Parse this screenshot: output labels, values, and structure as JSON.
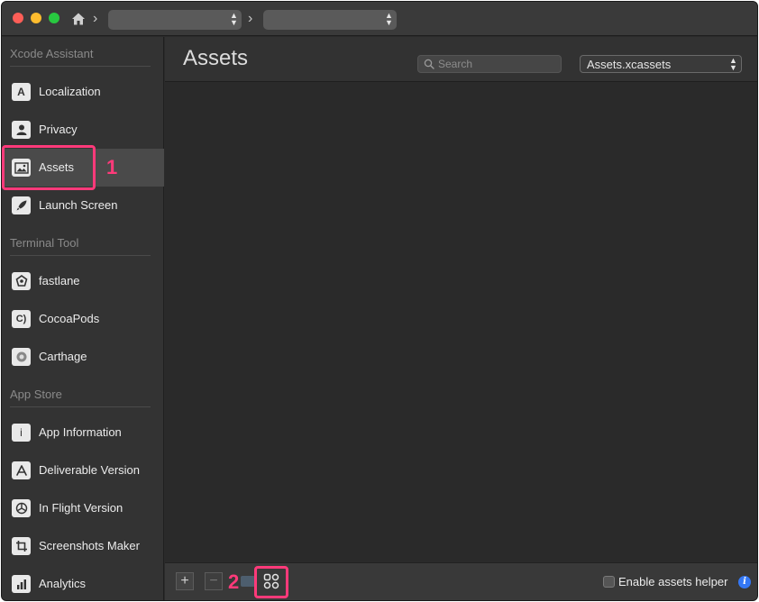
{
  "titlebar": {
    "breadcrumb_1": "",
    "breadcrumb_2": ""
  },
  "sidebar": {
    "sections": [
      {
        "title": "Xcode Assistant",
        "items": [
          {
            "label": "Localization",
            "icon": "letter-a-icon"
          },
          {
            "label": "Privacy",
            "icon": "person-icon"
          },
          {
            "label": "Assets",
            "icon": "image-icon"
          },
          {
            "label": "Launch Screen",
            "icon": "rocket-icon"
          }
        ]
      },
      {
        "title": "Terminal Tool",
        "items": [
          {
            "label": "fastlane",
            "icon": "fastlane-icon"
          },
          {
            "label": "CocoaPods",
            "icon": "cocoapods-icon"
          },
          {
            "label": "Carthage",
            "icon": "carthage-icon"
          }
        ]
      },
      {
        "title": "App Store",
        "items": [
          {
            "label": "App Information",
            "icon": "info-i-icon"
          },
          {
            "label": "Deliverable Version",
            "icon": "app-store-icon"
          },
          {
            "label": "In Flight Version",
            "icon": "testflight-icon"
          },
          {
            "label": "Screenshots Maker",
            "icon": "crop-icon"
          },
          {
            "label": "Analytics",
            "icon": "analytics-icon"
          }
        ]
      }
    ],
    "selected": "Assets"
  },
  "main": {
    "title": "Assets",
    "search_placeholder": "Search",
    "file_select_value": "Assets.xcassets"
  },
  "bottombar": {
    "add_label": "+",
    "remove_label": "−",
    "enable_helper_label": "Enable assets helper",
    "info_label": "i"
  },
  "callouts": {
    "one": "1",
    "two": "2",
    "color": "#ff3a7a"
  },
  "colors": {
    "accent_blue": "#3478f6"
  }
}
